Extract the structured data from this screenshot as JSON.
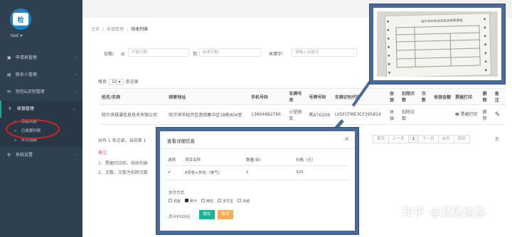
{
  "app": {
    "logo_text": "检",
    "user": "test ▾"
  },
  "sidebar": {
    "items": [
      {
        "icon": "▣",
        "label": "申请表管理",
        "arrow": "‹"
      },
      {
        "icon": "▤",
        "label": "联系人管理",
        "arrow": "‹"
      },
      {
        "icon": "✉",
        "label": "短信&识别管理",
        "arrow": "‹"
      },
      {
        "icon": "¥",
        "label": "收银管理",
        "arrow": "⌄"
      },
      {
        "icon": "⚙",
        "label": "系统设置",
        "arrow": "‹"
      }
    ],
    "sub_items": [
      {
        "icon": "»",
        "label": "待收列表"
      },
      {
        "icon": "»",
        "label": "已收银列表"
      },
      {
        "icon": "»",
        "label": "计次消费"
      }
    ]
  },
  "breadcrumb": {
    "home": "主页",
    "section": "收银管理",
    "current": "待收列表",
    "sep": "/"
  },
  "search": {
    "date_label": "日期：",
    "from_label": "从",
    "start_placeholder": "开始日期",
    "to_label": "到",
    "end_placeholder": "结束日期",
    "keyword_label": "关键字：",
    "keyword_placeholder": "请输入关键词"
  },
  "pagination": {
    "per_page_prefix": "每页",
    "per_page_value": "10 ▾",
    "per_page_suffix": "条记录",
    "summary": "共有 1 条记录，当前第 1",
    "pages": [
      "首页",
      "上一页",
      "1",
      "下一页",
      "末页",
      "转到"
    ],
    "page_suffix": "页"
  },
  "table": {
    "headers": [
      "姓名/名称",
      "邮寄地址",
      "手机号码",
      "车牌号类",
      "号牌号码",
      "车辆识别代码",
      "收银",
      "扣除次数",
      "次数",
      "收银金额",
      "票据打印",
      "删除",
      "备注"
    ],
    "row": {
      "name": "哈尔滨慧通信息技术有限公司",
      "address": "哈尔滨市经开区南岗集中区18栋804室",
      "phone": "13604882766",
      "plate_type": "小型轿车",
      "plate_no": "黑A7G206",
      "vin": "LVSFCFME3CF395824",
      "cashier": "收银",
      "deduct": "扣除次数",
      "count": "",
      "amount": "",
      "print": "票据打印",
      "delete": "删除",
      "note_icon": "✎"
    }
  },
  "notes": {
    "title": "备注：",
    "lines": [
      "1．票据打印后，待收列表",
      "2．次数，次数为扣除次数"
    ]
  },
  "modal": {
    "title": "查看详细信息",
    "close": "×",
    "headers": [
      "选择",
      "项目名称",
      "数量(台)",
      "价格（元）"
    ],
    "row": {
      "checked": "✔",
      "item": "8安检+外检（单气）",
      "qty": "1",
      "price": "320"
    },
    "pay_title": "支付方式",
    "pay_options": [
      {
        "label": "现金",
        "checked": false
      },
      {
        "label": "刷卡",
        "checked": true
      },
      {
        "label": "微信",
        "checked": false
      },
      {
        "label": "支付宝",
        "checked": false
      },
      {
        "label": "月结",
        "checked": false
      }
    ],
    "total": "总计¥320元",
    "submit": "提交",
    "cancel": "取消"
  },
  "receipt": {
    "title": "哈尔滨市机动车检测收费票据"
  },
  "watermark": "知乎 @慧通信息",
  "colors": {
    "sidebar": "#2f4050",
    "accent": "#1ab394",
    "link": "#1c84c6",
    "danger": "#ed5565",
    "frame": "#4a6a9a",
    "annotation": "#e02020"
  }
}
